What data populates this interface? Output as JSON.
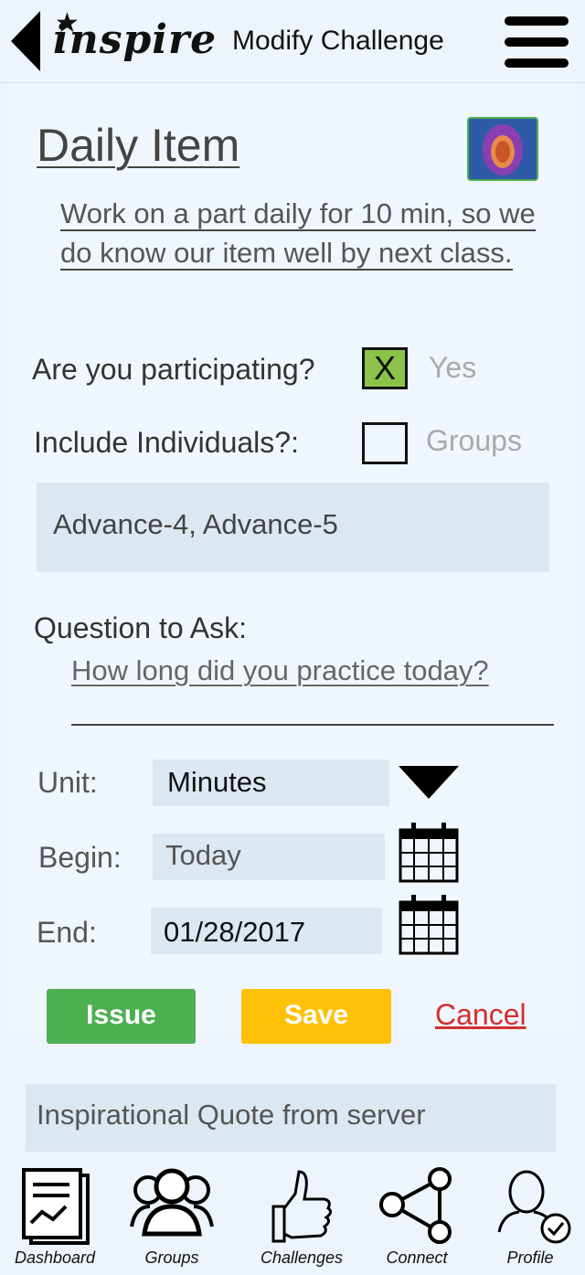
{
  "header": {
    "logo_text": "inspire",
    "title": "Modify Challenge"
  },
  "challenge": {
    "title": "Daily Item",
    "description": "Work on a part daily for 10 min, so we do know our item well by next class."
  },
  "participating": {
    "label": "Are you participating?",
    "checkbox_mark": "X",
    "checked": true,
    "option_label": "Yes"
  },
  "individuals": {
    "label": "Include Individuals?:",
    "checked": false,
    "option_label": "Groups"
  },
  "individuals_list": "Advance-4, Advance-5",
  "question": {
    "label": "Question to Ask:",
    "value": "How long did you practice today?"
  },
  "unit": {
    "label": "Unit:",
    "value": "Minutes"
  },
  "begin": {
    "label": "Begin:",
    "value": "Today"
  },
  "end": {
    "label": "End:",
    "value": "01/28/2017"
  },
  "actions": {
    "issue": "Issue",
    "save": "Save",
    "cancel": "Cancel"
  },
  "quote": "Inspirational Quote from server",
  "bottom_nav": [
    {
      "label": "Dashboard",
      "icon": "dashboard-icon"
    },
    {
      "label": "Groups",
      "icon": "groups-icon"
    },
    {
      "label": "Challenges",
      "icon": "thumbs-up-icon"
    },
    {
      "label": "Connect",
      "icon": "share-icon"
    },
    {
      "label": "Profile",
      "icon": "profile-check-icon"
    }
  ],
  "colors": {
    "issue": "#4caf50",
    "save": "#ffc107",
    "cancel": "#d32f2f",
    "checkbox_checked": "#8bc34a"
  }
}
